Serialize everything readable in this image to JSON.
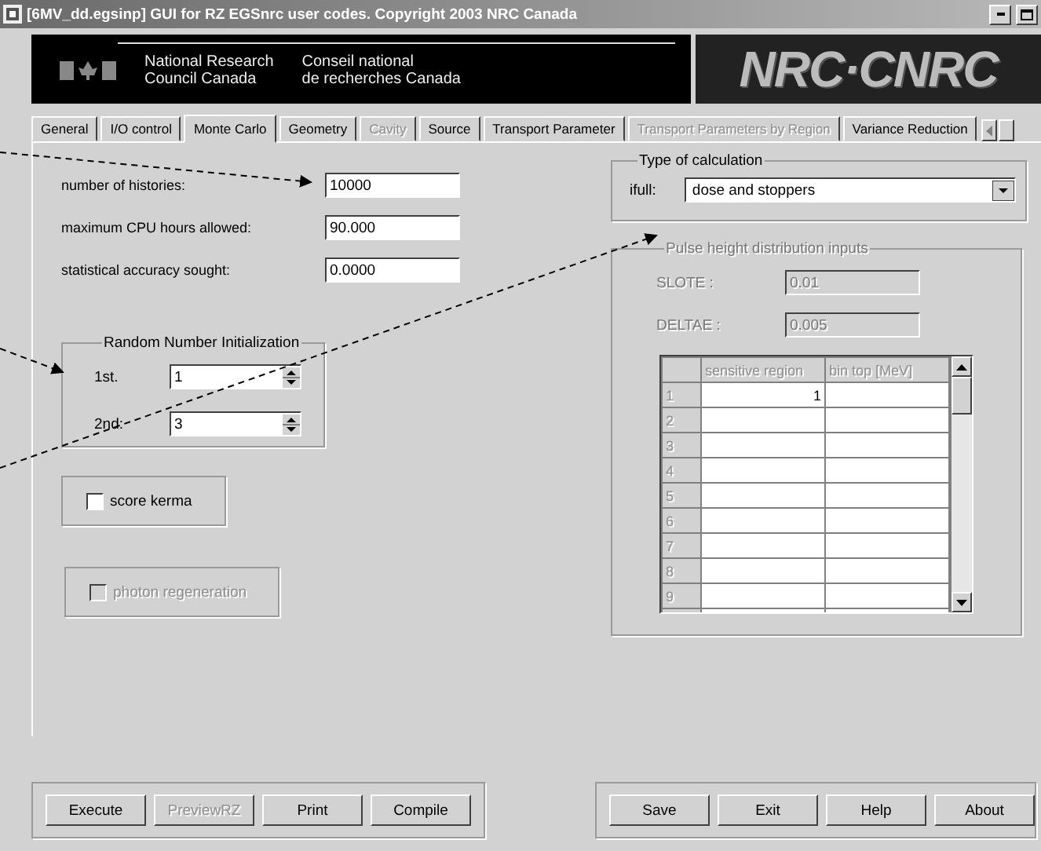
{
  "window": {
    "title": "[6MV_dd.egsinp] GUI for RZ EGSnrc user codes. Copyright 2003 NRC Canada"
  },
  "banner": {
    "english": [
      "National Research",
      "Council Canada"
    ],
    "french": [
      "Conseil national",
      "de recherches Canada"
    ],
    "logo": "NRC·CNRC"
  },
  "tabs": [
    {
      "label": "General",
      "selected": false,
      "disabled": false
    },
    {
      "label": "I/O control",
      "selected": false,
      "disabled": false
    },
    {
      "label": "Monte Carlo",
      "selected": true,
      "disabled": false
    },
    {
      "label": "Geometry",
      "selected": false,
      "disabled": false
    },
    {
      "label": "Cavity",
      "selected": false,
      "disabled": true
    },
    {
      "label": "Source",
      "selected": false,
      "disabled": false
    },
    {
      "label": "Transport Parameter",
      "selected": false,
      "disabled": false
    },
    {
      "label": "Transport Parameters by Region",
      "selected": false,
      "disabled": true
    },
    {
      "label": "Variance Reduction",
      "selected": false,
      "disabled": false
    }
  ],
  "monte_carlo": {
    "fields": [
      {
        "label": "number of histories:",
        "value": "10000"
      },
      {
        "label": "maximum CPU hours allowed:",
        "value": "90.000"
      },
      {
        "label": "statistical accuracy sought:",
        "value": "0.0000"
      }
    ],
    "random_number_initialization": {
      "title": "Random Number Initialization",
      "seeds": [
        {
          "label": "1st.",
          "value": "1"
        },
        {
          "label": "2nd:",
          "value": "3"
        }
      ]
    },
    "options": [
      {
        "label": "score kerma",
        "checked": false,
        "disabled": false
      },
      {
        "label": "photon regeneration",
        "checked": false,
        "disabled": true
      }
    ]
  },
  "type_of_calculation": {
    "title": "Type of calculation",
    "label": "ifull:",
    "value": "dose and stoppers"
  },
  "pulse_height": {
    "title": "Pulse height distribution inputs",
    "disabled": true,
    "fields": [
      {
        "label": "SLOTE :",
        "value": "0.01"
      },
      {
        "label": "DELTAE :",
        "value": "0.005"
      }
    ],
    "table": {
      "columns": [
        "sensitive region",
        "bin top [MeV]"
      ],
      "rows": [
        {
          "number": "1",
          "sensitive_region": "1"
        },
        {
          "number": "2"
        },
        {
          "number": "3"
        },
        {
          "number": "4"
        },
        {
          "number": "5"
        },
        {
          "number": "6"
        },
        {
          "number": "7"
        },
        {
          "number": "8"
        },
        {
          "number": "9"
        }
      ]
    }
  },
  "buttons_left": [
    {
      "label": "Execute",
      "disabled": false
    },
    {
      "label": "PreviewRZ",
      "disabled": true
    },
    {
      "label": "Print",
      "disabled": false
    },
    {
      "label": "Compile",
      "disabled": false
    }
  ],
  "buttons_right": [
    {
      "label": "Save",
      "disabled": false
    },
    {
      "label": "Exit",
      "disabled": false
    },
    {
      "label": "Help",
      "disabled": false
    },
    {
      "label": "About",
      "disabled": false
    }
  ]
}
